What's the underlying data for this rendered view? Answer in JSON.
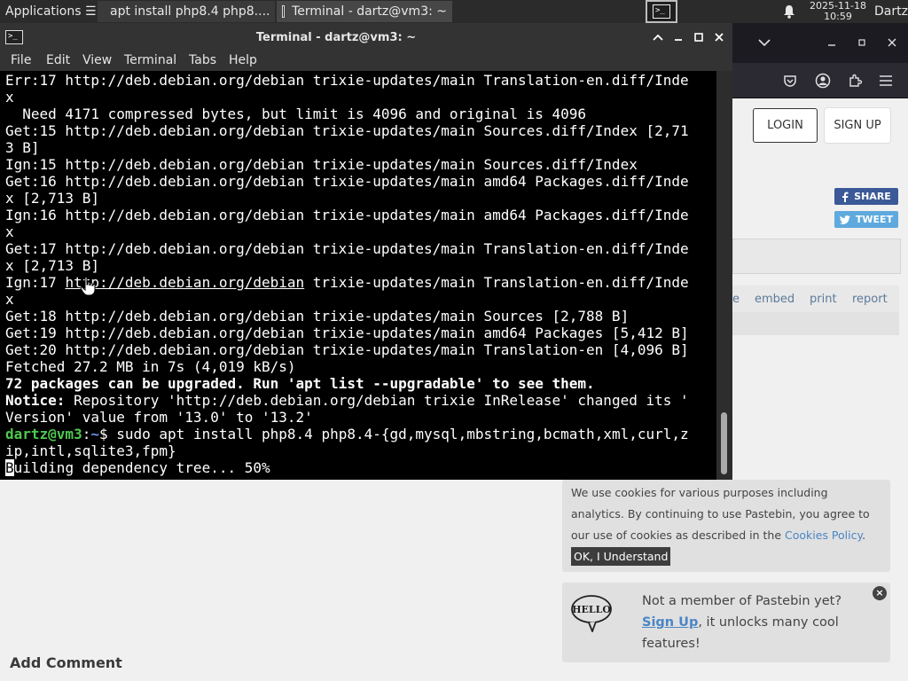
{
  "panel": {
    "applications_label": "Applications ☰",
    "tasks": [
      {
        "label": "apt install php8.4 php8...."
      },
      {
        "label": "Terminal - dartz@vm3: ~"
      }
    ],
    "clock_date": "2025-11-18",
    "clock_time": "10:59",
    "user": "Dartz"
  },
  "terminal": {
    "title": "Terminal - dartz@vm3: ~",
    "menu": [
      "File",
      "Edit",
      "View",
      "Terminal",
      "Tabs",
      "Help"
    ],
    "lines": [
      "Err:17 http://deb.debian.org/debian trixie-updates/main Translation-en.diff/Inde",
      "x",
      "  Need 4171 compressed bytes, but limit is 4096 and original is 4096",
      "Get:15 http://deb.debian.org/debian trixie-updates/main Sources.diff/Index [2,71",
      "3 B]",
      "Ign:15 http://deb.debian.org/debian trixie-updates/main Sources.diff/Index",
      "Get:16 http://deb.debian.org/debian trixie-updates/main amd64 Packages.diff/Inde",
      "x [2,713 B]",
      "Ign:16 http://deb.debian.org/debian trixie-updates/main amd64 Packages.diff/Inde",
      "x",
      "Get:17 http://deb.debian.org/debian trixie-updates/main Translation-en.diff/Inde",
      "x [2,713 B]",
      "Ign:17 ",
      "x",
      "Get:18 http://deb.debian.org/debian trixie-updates/main Sources [2,788 B]",
      "Get:19 http://deb.debian.org/debian trixie-updates/main amd64 Packages [5,412 B]",
      "Get:20 http://deb.debian.org/debian trixie-updates/main Translation-en [4,096 B]",
      "Fetched 27.2 MB in 7s (4,019 kB/s)",
      "72 packages can be upgraded. Run 'apt list --upgradable' to see them.",
      "Notice:",
      "Version' value from '13.0' to '13.2'",
      "",
      "ip,intl,sqlite3,fpm}",
      ""
    ],
    "ign17_url": "http://deb.debian.org/debian",
    "ign17_rest": " trixie-updates/main Translation-en.diff/Inde",
    "notice_rest": " Repository 'http://deb.debian.org/debian trixie InRelease' changed its '",
    "prompt_user": "dartz@vm3",
    "prompt_sep": ":",
    "prompt_path": "~",
    "prompt_cmd": "$ sudo apt install php8.4 php8.4-{gd,mysql,mbstring,bcmath,xml,curl,z",
    "progress_first_char": "B",
    "progress_rest": "uilding dependency tree... 50%"
  },
  "firefox": {
    "login_label": "LOGIN",
    "signup_label": "SIGN UP",
    "share_label": "SHARE",
    "tweet_label": "TWEET",
    "action_partial": "e",
    "actions": [
      "embed",
      "print",
      "report"
    ]
  },
  "pastebin": {
    "add_comment": "Add Comment",
    "cookie_text_1": "We use cookies for various purposes including analytics. By continuing to use Pastebin, you agree to our use of cookies as described in the ",
    "cookie_link": "Cookies Policy",
    "cookie_text_2": ". ",
    "cookie_ok": "OK, I Understand",
    "promo_text_1": "Not a member of Pastebin yet?",
    "promo_link": "Sign Up",
    "promo_text_2": ", it unlocks many cool features!",
    "hello_badge": "HELLO"
  },
  "colors": {
    "prompt_user": "#4ec94e",
    "prompt_path": "#6f8ff0",
    "share_bg": "#3b5998",
    "tweet_bg": "#5ea9dd",
    "link": "#4a86c5"
  }
}
